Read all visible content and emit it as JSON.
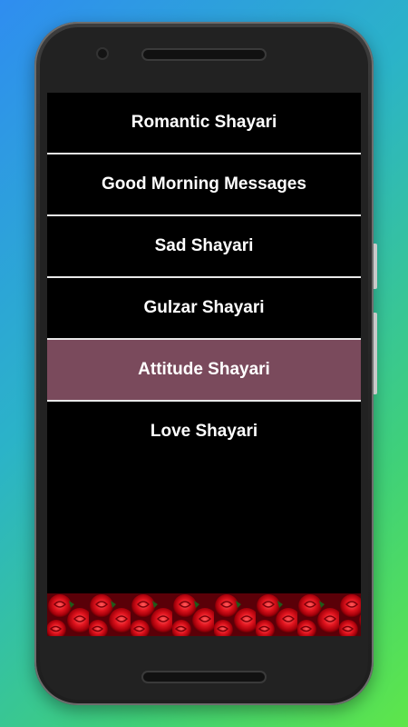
{
  "menu": {
    "items": [
      {
        "label": "Romantic Shayari"
      },
      {
        "label": "Good Morning Messages"
      },
      {
        "label": "Sad Shayari"
      },
      {
        "label": "Gulzar Shayari"
      },
      {
        "label": "Attitude Shayari"
      },
      {
        "label": "Love Shayari"
      }
    ],
    "selected_index": 4
  },
  "banner": {
    "image": "red-roses-banner"
  },
  "colors": {
    "background_gradient_start": "#2f8df0",
    "background_gradient_end": "#5ee64a",
    "screen": "#000000",
    "selected_item": "#7a4a5c",
    "item_text": "#ffffff",
    "divider": "#e8e8e8"
  }
}
